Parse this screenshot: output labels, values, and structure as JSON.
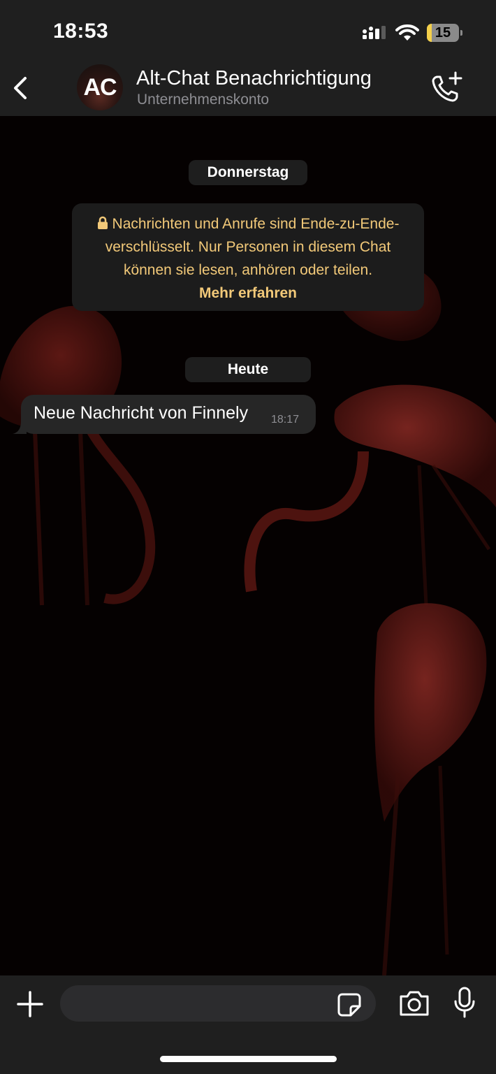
{
  "status_bar": {
    "time": "18:53",
    "battery_level": "15",
    "battery_fraction": 0.15,
    "icons": [
      "signal-icon",
      "wifi-icon",
      "battery-icon"
    ]
  },
  "header": {
    "avatar_text": "AC",
    "title": "Alt-Chat Benachrichtigung",
    "subtitle": "Unternehmenskonto",
    "icons": [
      "back-chevron-icon",
      "add-call-icon"
    ]
  },
  "chat": {
    "date_pill_1": "Donnerstag",
    "encryption_notice": "Nachrichten und Anrufe sind Ende-zu-Ende-verschlüsselt. Nur Personen in diesem Chat können sie lesen, anhören oder teilen.",
    "encryption_link": "Mehr erfahren",
    "date_pill_2": "Heute",
    "messages": [
      {
        "text": "Neue Nachricht von Finnely",
        "time": "18:17"
      }
    ]
  },
  "input_bar": {
    "placeholder": "",
    "icons": [
      "plus-icon",
      "sticker-icon",
      "camera-icon",
      "microphone-icon"
    ]
  },
  "colors": {
    "bar_background": "#1f1f1f",
    "notice_text": "#f2c979",
    "bubble": "#262626",
    "battery_fill": "#f4d04a"
  }
}
